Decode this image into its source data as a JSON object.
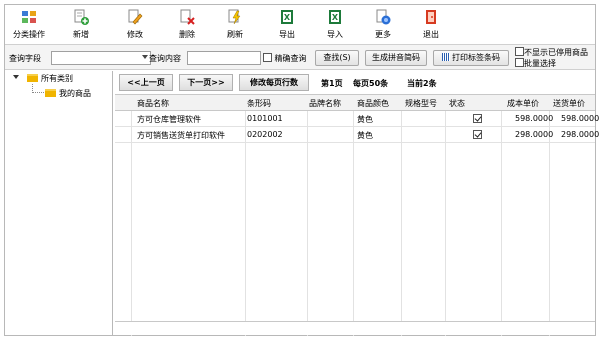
{
  "toolbar": {
    "items": [
      {
        "label": "分类操作",
        "icon": "category-icon"
      },
      {
        "label": "新增",
        "icon": "add-icon"
      },
      {
        "label": "修改",
        "icon": "edit-icon"
      },
      {
        "label": "删除",
        "icon": "delete-icon"
      },
      {
        "label": "刷新",
        "icon": "refresh-icon"
      },
      {
        "label": "导出",
        "icon": "export-icon"
      },
      {
        "label": "导入",
        "icon": "import-icon"
      },
      {
        "label": "更多",
        "icon": "more-icon"
      },
      {
        "label": "退出",
        "icon": "exit-icon"
      }
    ]
  },
  "query": {
    "field_label": "查询字段",
    "field_value": "",
    "content_label": "查询内容",
    "content_value": "",
    "exact_label": "精确查询",
    "search_button": "查找(S)",
    "pinyin_button": "生成拼音简码",
    "print_label_button": "打印标签条码",
    "hide_disabled_label": "不显示已停用商品",
    "batch_select_label": "批量选择"
  },
  "tree": {
    "root": "所有类别",
    "child": "我的商品"
  },
  "nav": {
    "prev": "<<上一页",
    "next": "下一页>>",
    "rows_per_page": "修改每页行数",
    "page": "第1页",
    "per_page": "每页50条",
    "total": "当前2条"
  },
  "table": {
    "columns": [
      "商品名称",
      "条形码",
      "品牌名称",
      "商品颜色",
      "规格型号",
      "状态",
      "成本单价",
      "送货单价"
    ],
    "rows": [
      {
        "name": "方可仓库管理软件",
        "barcode": "0101001",
        "brand": "",
        "color": "黄色",
        "spec": "",
        "status": true,
        "cost": "598.0000",
        "price": "598.0000"
      },
      {
        "name": "方可销售送货单打印软件",
        "barcode": "0202002",
        "brand": "",
        "color": "黄色",
        "spec": "",
        "status": true,
        "cost": "298.0000",
        "price": "298.0000"
      }
    ]
  },
  "colors": {
    "folder": "#f0b400",
    "border": "#b8b8b8"
  }
}
